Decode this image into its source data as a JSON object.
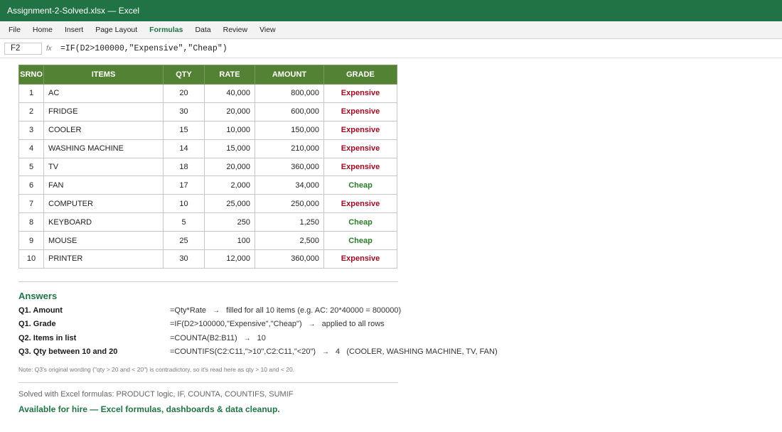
{
  "window": {
    "title": "Assignment-2-Solved.xlsx — Excel"
  },
  "menu": {
    "items": [
      "File",
      "Home",
      "Insert",
      "Page Layout",
      "Formulas",
      "Data",
      "Review",
      "View"
    ],
    "active": "Formulas"
  },
  "formula_bar": {
    "cell_ref": "F2",
    "fx": "fx",
    "formula": "=IF(D2>100000,\"Expensive\",\"Cheap\")"
  },
  "table": {
    "headers": [
      "SRNO",
      "ITEMS",
      "QTY",
      "RATE",
      "AMOUNT",
      "GRADE"
    ],
    "rows": [
      {
        "srno": "1",
        "item": "AC",
        "qty": "20",
        "rate": "40,000",
        "amount": "800,000",
        "grade": "Expensive"
      },
      {
        "srno": "2",
        "item": "FRIDGE",
        "qty": "30",
        "rate": "20,000",
        "amount": "600,000",
        "grade": "Expensive"
      },
      {
        "srno": "3",
        "item": "COOLER",
        "qty": "15",
        "rate": "10,000",
        "amount": "150,000",
        "grade": "Expensive"
      },
      {
        "srno": "4",
        "item": "WASHING MACHINE",
        "qty": "14",
        "rate": "15,000",
        "amount": "210,000",
        "grade": "Expensive"
      },
      {
        "srno": "5",
        "item": "TV",
        "qty": "18",
        "rate": "20,000",
        "amount": "360,000",
        "grade": "Expensive"
      },
      {
        "srno": "6",
        "item": "FAN",
        "qty": "17",
        "rate": "2,000",
        "amount": "34,000",
        "grade": "Cheap"
      },
      {
        "srno": "7",
        "item": "COMPUTER",
        "qty": "10",
        "rate": "25,000",
        "amount": "250,000",
        "grade": "Expensive"
      },
      {
        "srno": "8",
        "item": "KEYBOARD",
        "qty": "5",
        "rate": "250",
        "amount": "1,250",
        "grade": "Cheap"
      },
      {
        "srno": "9",
        "item": "MOUSE",
        "qty": "25",
        "rate": "100",
        "amount": "2,500",
        "grade": "Cheap"
      },
      {
        "srno": "10",
        "item": "PRINTER",
        "qty": "30",
        "rate": "12,000",
        "amount": "360,000",
        "grade": "Expensive"
      }
    ]
  },
  "answers": {
    "title": "Answers",
    "items": [
      {
        "label": "Q1. Amount",
        "formula": "=Qty*Rate",
        "arrow": "→",
        "result": "filled for all 10 items (e.g. AC: 20*40000 = 800000)"
      },
      {
        "label": "Q1. Grade",
        "formula": "=IF(D2>100000,\"Expensive\",\"Cheap\")",
        "arrow": "→",
        "result": "applied to all rows"
      },
      {
        "label": "Q2. Items in list",
        "formula": "=COUNTA(B2:B11)",
        "arrow": "→",
        "result": "10"
      },
      {
        "label": "Q3. Qty between 10 and 20",
        "formula": "=COUNTIFS(C2:C11,\">10\",C2:C11,\"<20\")",
        "arrow": "→",
        "result": "4   (COOLER, WASHING MACHINE, TV, FAN)"
      }
    ],
    "note": "Note: Q3's original wording (\"qty > 20 and < 20\") is contradictory, so it's read here as qty > 10 and < 20."
  },
  "footer": {
    "solved_with": "Solved with Excel formulas: PRODUCT logic, IF, COUNTA, COUNTIFS, SUMIF",
    "hire": "Available for hire — Excel formulas, dashboards & data cleanup."
  },
  "colors": {
    "title_bar": "#217346",
    "header_fill": "#548235",
    "expensive": "#9c0b24",
    "cheap": "#2d7a2d"
  }
}
